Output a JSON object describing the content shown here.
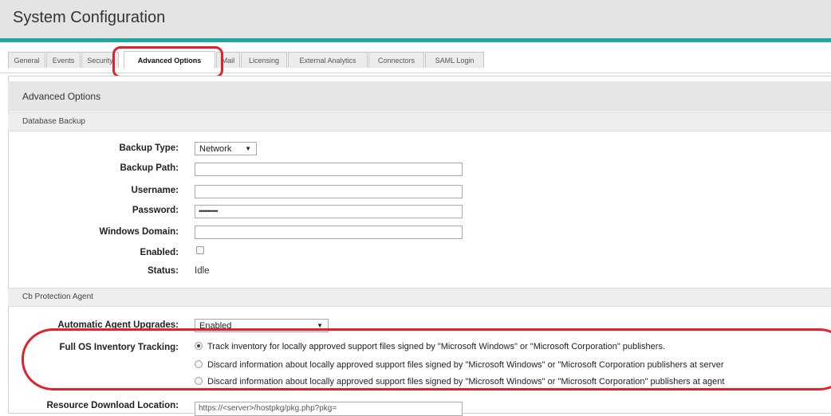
{
  "header": {
    "title": "System Configuration",
    "accent_color": "#1fa5a0"
  },
  "tabs": [
    {
      "label": "General"
    },
    {
      "label": "Events"
    },
    {
      "label": "Security"
    },
    {
      "label": "Advanced Options",
      "active": true
    },
    {
      "label": "Mail"
    },
    {
      "label": "Licensing"
    },
    {
      "label": "External Analytics"
    },
    {
      "label": "Connectors"
    },
    {
      "label": "SAML Login"
    }
  ],
  "highlight_color": "#e0232a",
  "panel": {
    "title": "Advanced Options"
  },
  "database_backup": {
    "section_title": "Database Backup",
    "backup_type": {
      "label": "Backup Type:",
      "value": "Network"
    },
    "backup_path": {
      "label": "Backup Path:",
      "value": ""
    },
    "username": {
      "label": "Username:",
      "value": ""
    },
    "password": {
      "label": "Password:",
      "value": "•••••••••••"
    },
    "windows_domain": {
      "label": "Windows Domain:",
      "value": ""
    },
    "enabled": {
      "label": "Enabled:",
      "checked": false
    },
    "status": {
      "label": "Status:",
      "value": "Idle"
    }
  },
  "agent": {
    "section_title": "Cb Protection Agent",
    "auto_upgrades": {
      "label": "Automatic Agent Upgrades:",
      "value": "Enabled"
    },
    "inventory": {
      "label": "Full OS Inventory Tracking:",
      "options": [
        {
          "text": "Track inventory for locally approved support files signed by \"Microsoft Windows\" or \"Microsoft Corporation\" publishers.",
          "selected": true
        },
        {
          "text": "Discard information about locally approved support files signed by \"Microsoft Windows\" or \"Microsoft Corporation publishers at server",
          "selected": false
        },
        {
          "text": "Discard information about locally approved support files signed by \"Microsoft Windows\" or \"Microsoft Corporation\" publishers at agent",
          "selected": false
        }
      ]
    },
    "resource_location": {
      "label": "Resource Download Location:",
      "value": "https://<server>/hostpkg/pkg.php?pkg="
    }
  }
}
